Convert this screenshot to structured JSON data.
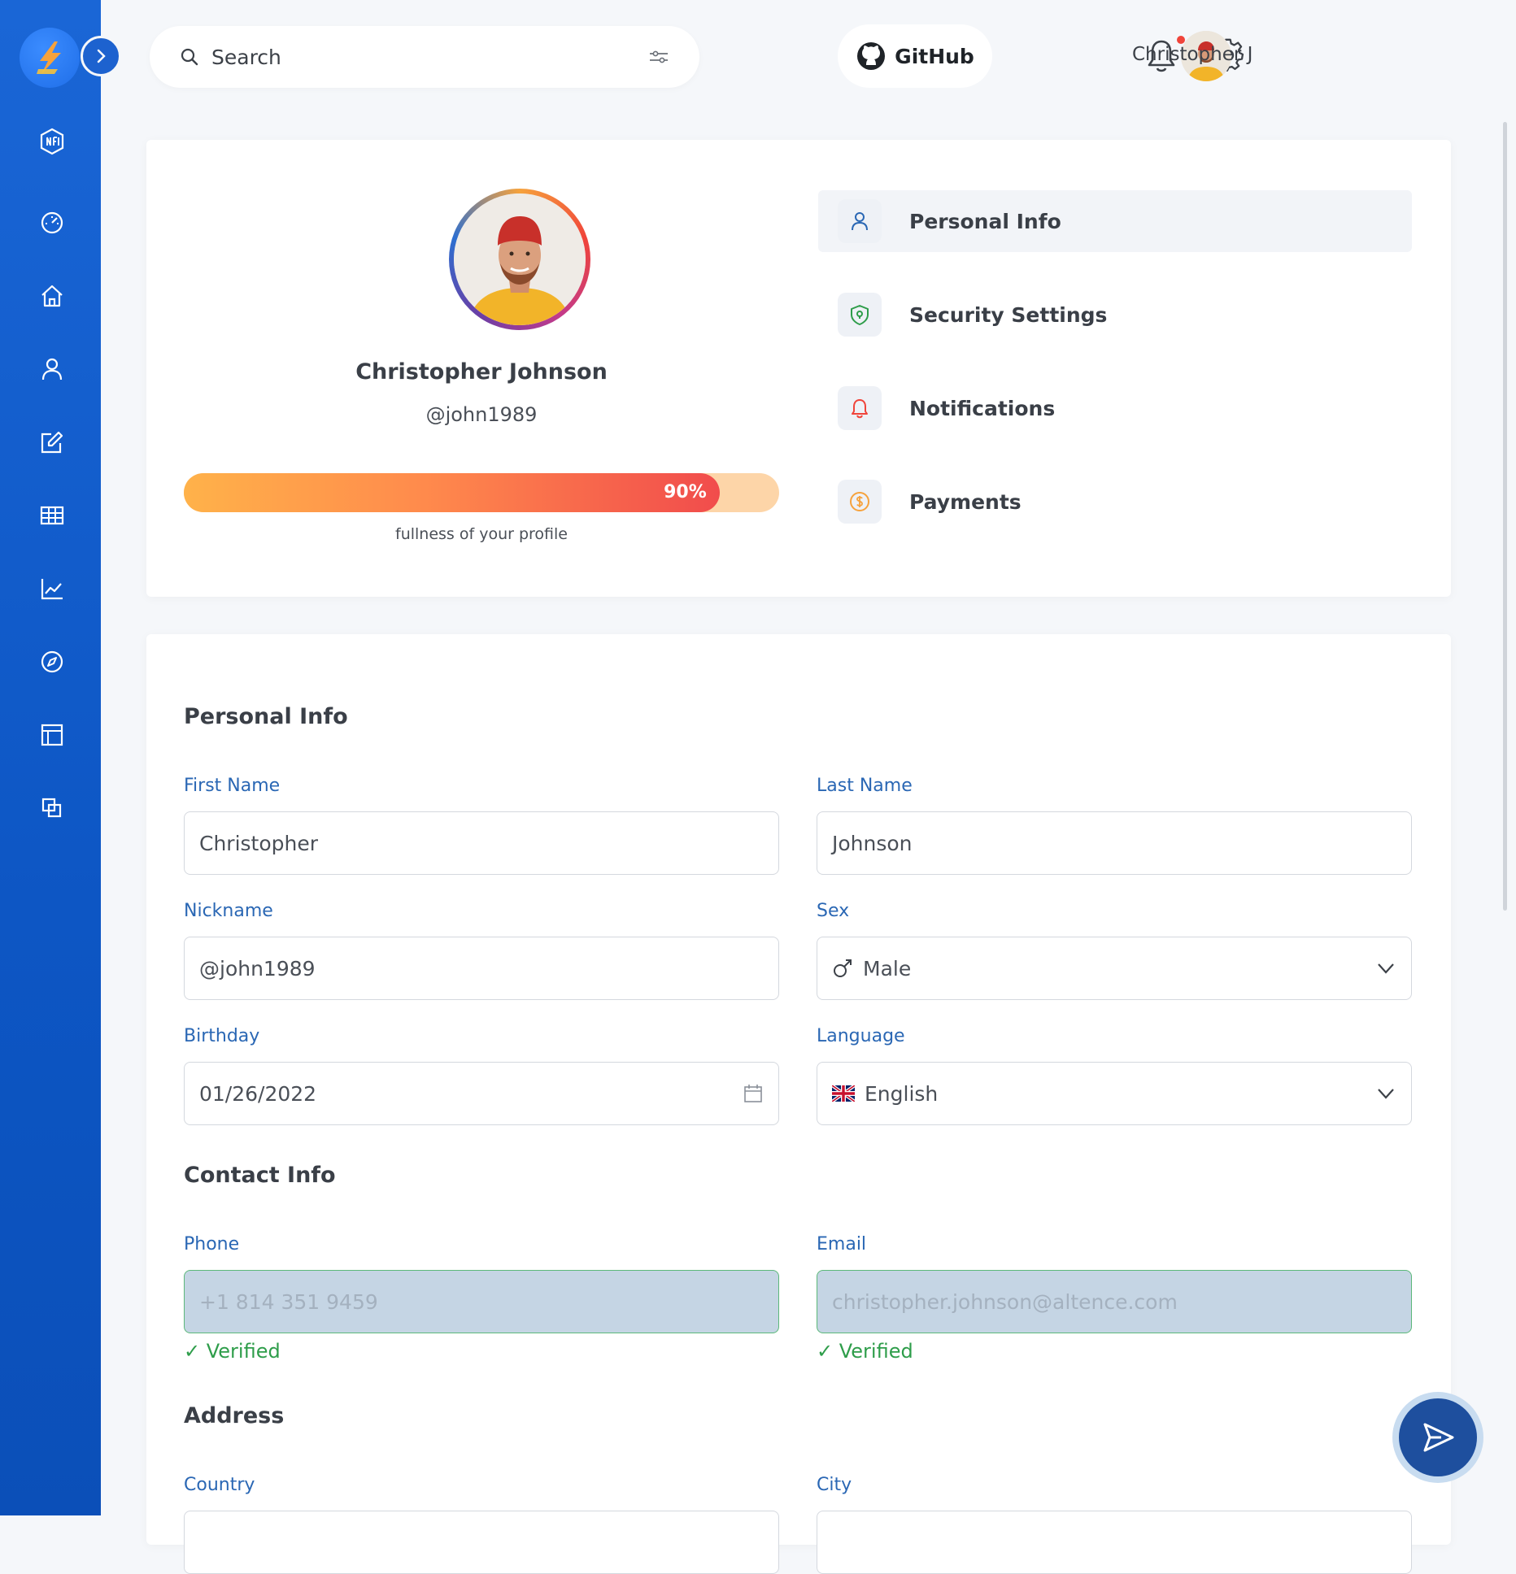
{
  "topbar": {
    "search_placeholder": "Search",
    "github_label": "GitHub",
    "user_name": "Christopher J"
  },
  "sidebar": {
    "items": [
      {
        "icon": "nft-icon"
      },
      {
        "icon": "dashboard-gauge-icon"
      },
      {
        "icon": "home-icon"
      },
      {
        "icon": "user-icon"
      },
      {
        "icon": "edit-icon"
      },
      {
        "icon": "table-icon"
      },
      {
        "icon": "chart-icon"
      },
      {
        "icon": "compass-icon"
      },
      {
        "icon": "layout-icon"
      },
      {
        "icon": "copy-icon"
      }
    ]
  },
  "profile": {
    "name": "Christopher Johnson",
    "handle": "@john1989",
    "progress_value": 0.9,
    "progress_label": "90%",
    "progress_caption": "fullness of your profile"
  },
  "menu": {
    "items": [
      {
        "label": "Personal Info",
        "icon": "user-icon",
        "color": "#2a67b4",
        "active": true
      },
      {
        "label": "Security Settings",
        "icon": "shield-icon",
        "color": "#2e9d4a",
        "active": false
      },
      {
        "label": "Notifications",
        "icon": "bell-icon",
        "color": "#f0443a",
        "active": false
      },
      {
        "label": "Payments",
        "icon": "dollar-icon",
        "color": "#f6a23c",
        "active": false
      }
    ]
  },
  "personal_info": {
    "title": "Personal Info",
    "first_name_label": "First Name",
    "first_name_value": "Christopher",
    "last_name_label": "Last Name",
    "last_name_value": "Johnson",
    "nickname_label": "Nickname",
    "nickname_value": "@john1989",
    "sex_label": "Sex",
    "sex_value": "Male",
    "birthday_label": "Birthday",
    "birthday_value": "01/26/2022",
    "language_label": "Language",
    "language_value": "English"
  },
  "contact_info": {
    "title": "Contact Info",
    "phone_label": "Phone",
    "phone_value": "+1 814 351 9459",
    "email_label": "Email",
    "email_value": "christopher.johnson@altence.com",
    "verified_label": "✓ Verified"
  },
  "address": {
    "title": "Address",
    "country_label": "Country",
    "city_label": "City"
  },
  "colors": {
    "sidebar": "#1a66d6",
    "accent": "#2a67b4",
    "verified": "#2e9d4a",
    "progress_start": "#ffb24a",
    "progress_end": "#f14c4c"
  }
}
